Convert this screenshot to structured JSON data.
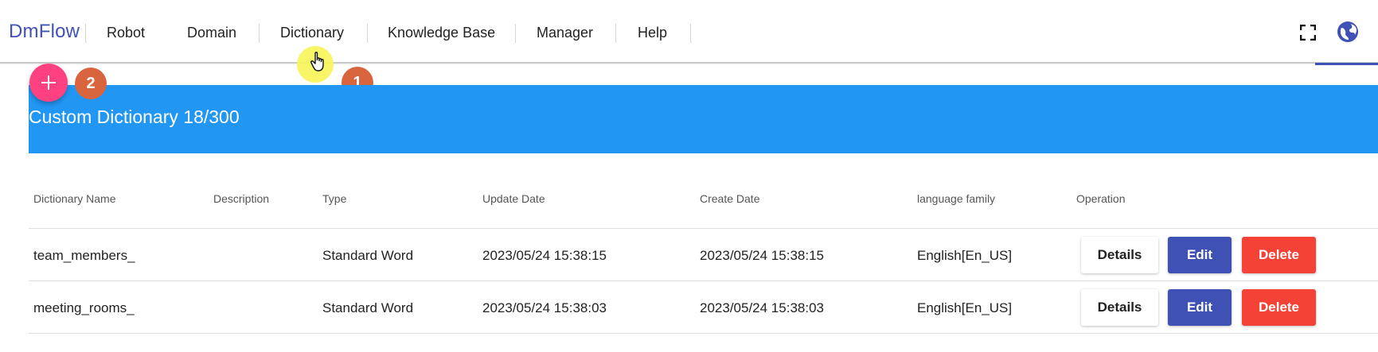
{
  "brand": "DmFlow",
  "nav": {
    "items": [
      {
        "label": "Robot"
      },
      {
        "label": "Domain"
      },
      {
        "label": "Dictionary"
      },
      {
        "label": "Knowledge Base"
      },
      {
        "label": "Manager"
      },
      {
        "label": "Help"
      }
    ]
  },
  "header_icons": [
    "fullscreen-icon",
    "globe-icon"
  ],
  "annotations": {
    "marker1": "1",
    "marker2": "2"
  },
  "fab": {
    "icon": "plus-icon"
  },
  "banner": {
    "title": "Custom Dictionary 18/300"
  },
  "table": {
    "columns": [
      "Dictionary Name",
      "Description",
      "Type",
      "Update Date",
      "Create Date",
      "language family",
      "Operation"
    ],
    "rows": [
      {
        "name": "team_members_",
        "description": "",
        "type": "Standard Word",
        "update_date": "2023/05/24 15:38:15",
        "create_date": "2023/05/24 15:38:15",
        "language": "English[En_US]"
      },
      {
        "name": "meeting_rooms_",
        "description": "",
        "type": "Standard Word",
        "update_date": "2023/05/24 15:38:03",
        "create_date": "2023/05/24 15:38:03",
        "language": "English[En_US]"
      }
    ],
    "buttons": {
      "details": "Details",
      "edit": "Edit",
      "delete": "Delete"
    }
  },
  "colors": {
    "brand": "#3f51b5",
    "banner": "#2196f3",
    "fab": "#ff4081",
    "edit": "#3f51b5",
    "delete": "#f44336",
    "marker": "#d9653e",
    "cursor_halo": "#f7f55a"
  }
}
